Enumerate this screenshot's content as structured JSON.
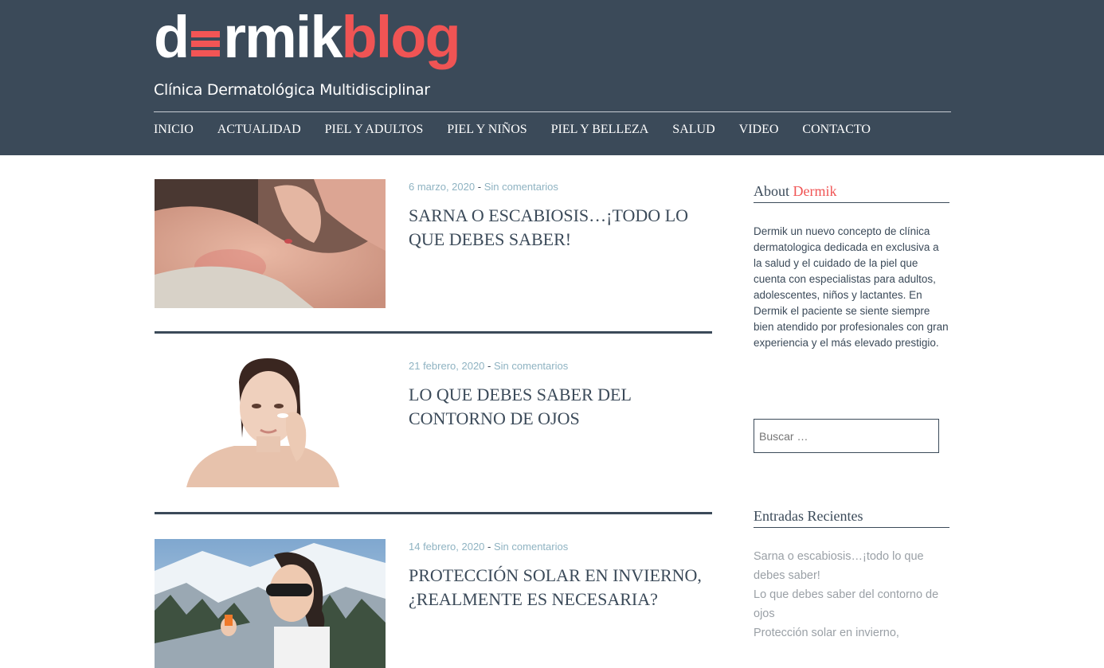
{
  "site": {
    "logo_word1_start": "d",
    "logo_word1_end": "rmik",
    "logo_word2": "blog",
    "tagline": "Clínica Dermatológica Multidisciplinar",
    "colors": {
      "header_bg": "#3b4a59",
      "accent": "#f05454",
      "meta": "#8fb3c2"
    }
  },
  "nav": [
    "INICIO",
    "ACTUALIDAD",
    "PIEL Y ADULTOS",
    "PIEL Y NIÑOS",
    "PIEL Y BELLEZA",
    "SALUD",
    "VIDEO",
    "CONTACTO"
  ],
  "posts": [
    {
      "date": "6 marzo, 2020",
      "sep": "-",
      "comments": "Sin comentarios",
      "title": "SARNA O ESCABIOSIS…¡TODO LO QUE DEBES SABER!",
      "image": "woman-scratching-shoulder-photo"
    },
    {
      "date": "21 febrero, 2020",
      "sep": "-",
      "comments": "Sin comentarios",
      "title": "LO QUE DEBES SABER DEL CONTORNO DE OJOS",
      "image": "woman-applying-eye-cream-photo"
    },
    {
      "date": "14 febrero, 2020",
      "sep": "-",
      "comments": "Sin comentarios",
      "title": "PROTECCIÓN SOLAR EN INVIERNO, ¿REALMENTE ES NECESARIA?",
      "image": "woman-sunglasses-snow-photo"
    }
  ],
  "sidebar": {
    "about_title": "About",
    "about_title_accent": "Dermik",
    "about_text": "Dermik un nuevo concepto de clínica dermatologica dedicada en exclusiva a la salud y el cuidado de la piel que cuenta con especialistas para adultos, adolescentes, niños y lactantes. En Dermik el paciente se siente siempre bien atendido por profesionales con gran experiencia y el más elevado prestigio.",
    "search_placeholder": "Buscar …",
    "recent_title": "Entradas Recientes",
    "recent": [
      "Sarna o escabiosis…¡todo lo que debes saber!",
      "Lo que debes saber del contorno de ojos",
      "Protección solar en invierno,"
    ]
  }
}
